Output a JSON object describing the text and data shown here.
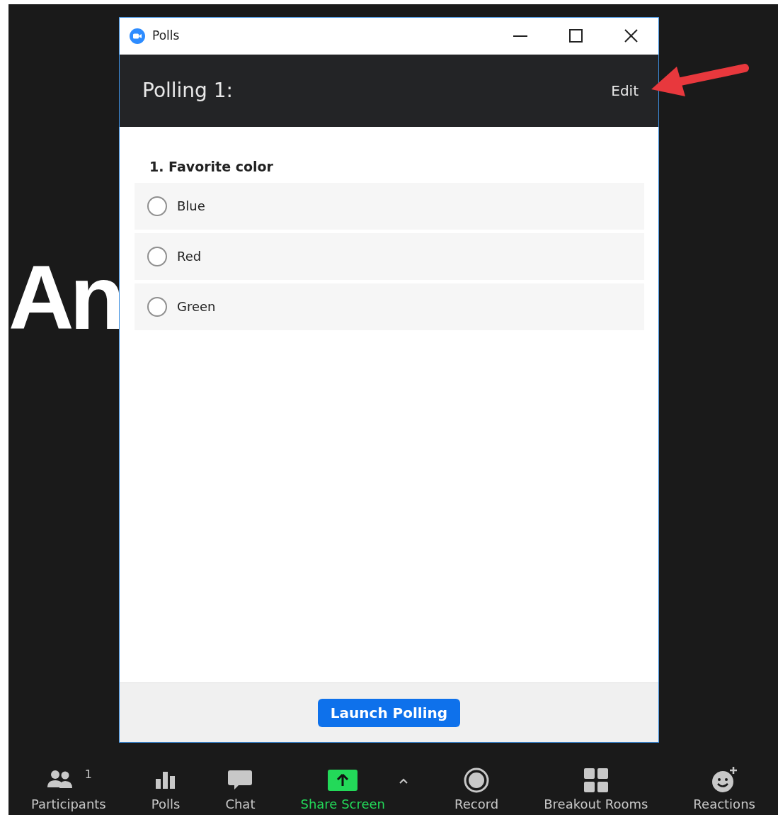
{
  "background_text": "An",
  "window": {
    "title": "Polls"
  },
  "header": {
    "title": "Polling 1:",
    "edit": "Edit"
  },
  "question": {
    "title": "1. Favorite color",
    "options": [
      {
        "label": "Blue",
        "selected": false
      },
      {
        "label": "Red",
        "selected": false
      },
      {
        "label": "Green",
        "selected": false
      }
    ]
  },
  "launch_button": "Launch Polling",
  "toolbar": [
    {
      "label": "Participants",
      "count": "1",
      "highlighted": false
    },
    {
      "label": "Polls",
      "highlighted": false
    },
    {
      "label": "Chat",
      "highlighted": false
    },
    {
      "label": "Share Screen",
      "highlighted": true
    },
    {
      "label": "Record",
      "highlighted": false
    },
    {
      "label": "Breakout Rooms",
      "highlighted": false
    },
    {
      "label": "Reactions",
      "highlighted": false
    }
  ]
}
